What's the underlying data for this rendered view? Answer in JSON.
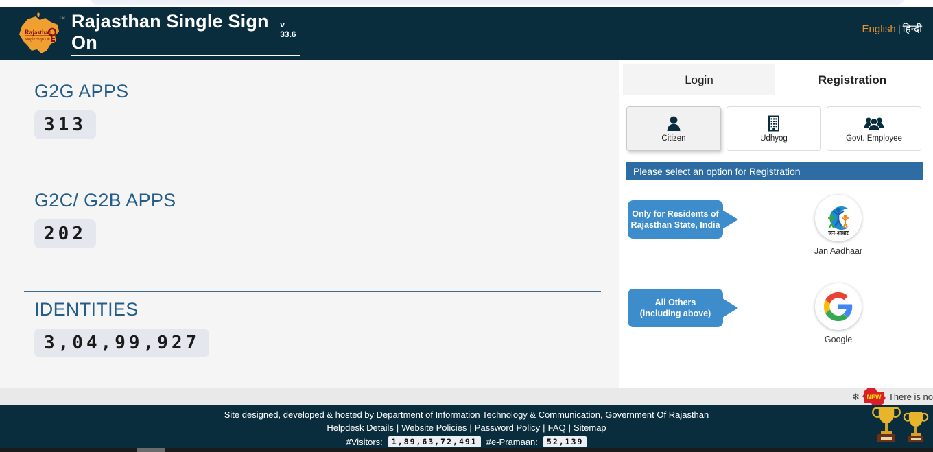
{
  "header": {
    "logo_alt": "rajasthan-sso-logo",
    "title": "Rajasthan Single Sign On",
    "version": "v 33.6",
    "tagline": "One Digital Identity for all Applications",
    "language": {
      "english": "English",
      "separator": "|",
      "hindi": "हिन्दी"
    }
  },
  "stats": [
    {
      "label": "G2G APPS",
      "value": "313"
    },
    {
      "label": "G2C/ G2B APPS",
      "value": "202"
    },
    {
      "label": "IDENTITIES",
      "value": "3,04,99,927"
    }
  ],
  "tabs": [
    {
      "label": "Login",
      "active": false
    },
    {
      "label": "Registration",
      "active": true
    }
  ],
  "roles": [
    {
      "label": "Citizen",
      "icon": "person-icon",
      "selected": true
    },
    {
      "label": "Udhyog",
      "icon": "building-icon",
      "selected": false
    },
    {
      "label": "Govt. Employee",
      "icon": "group-icon",
      "selected": false
    }
  ],
  "banner": "Please select an option for Registration",
  "options": [
    {
      "callout_line1": "Only for Residents of",
      "callout_line2": "Rajasthan State, India",
      "name": "Jan Aadhaar",
      "icon": "jan-aadhaar-logo",
      "logo_text": "जन-आधार"
    },
    {
      "callout_line1": "All Others",
      "callout_line2": "(including above)",
      "name": "Google",
      "icon": "google-logo",
      "logo_text": "G"
    }
  ],
  "ticker": {
    "snowflake": "❄",
    "badge": "NEW",
    "text": "There is no"
  },
  "footer": {
    "credit": "Site designed, developed & hosted by Department of Information Technology & Communication, Government Of Rajasthan",
    "links": [
      "Helpdesk Details",
      "Website Policies",
      "Password Policy",
      "FAQ",
      "Sitemap"
    ],
    "visitors_label": "#Visitors:",
    "visitors_value": "1,89,63,72,491",
    "epramaan_label": "#e-Pramaan:",
    "epramaan_value": "52,139"
  },
  "colors": {
    "header_bg": "#0a2d3e",
    "accent_orange": "#e8912a",
    "stat_label": "#255d88",
    "banner_blue": "#2e6da4",
    "callout_blue": "#3d8ccc"
  }
}
